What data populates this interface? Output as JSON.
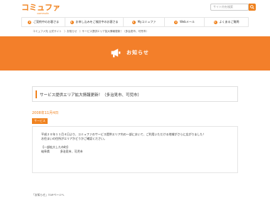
{
  "header": {
    "logo_text": "コミュファ",
    "logo_sub": "commufa",
    "search_placeholder": "サイト内を検索"
  },
  "gnav": {
    "items": [
      {
        "label": "ご契約中のお客さま"
      },
      {
        "label": "お申し込みをご検討中のお客さま"
      },
      {
        "label": "Myコミュファ"
      },
      {
        "label": "Webメール"
      },
      {
        "label": "よくあるご質問"
      }
    ]
  },
  "breadcrumb": "コミュファ光 公式サイト　〉お知らせ　〉サービス提供エリア拡大情報更新！（多治見市、可児市）",
  "banner": {
    "title": "お知らせ"
  },
  "article": {
    "title": "サービス提供エリア拡大情報更新！（多治見市、可児市）",
    "date": "2008年11月4日",
    "tag": "サービス",
    "body_lines": [
      "平成２０年１１月４日より、コミュファのサービス提供エリア内の一部において、ご利用いただける地域がさらに広がりました！",
      "お住まいの住所がエリアかどうかご確認ください。"
    ],
    "area_heading": "【一部拡大した市町】",
    "area_prefecture": "岐阜県",
    "area_cities": "多治見市、可児市"
  },
  "back_link": "「お知らせ」TOPページへ",
  "colors": {
    "accent": "#f0821e",
    "banner": "#f37f2a"
  }
}
